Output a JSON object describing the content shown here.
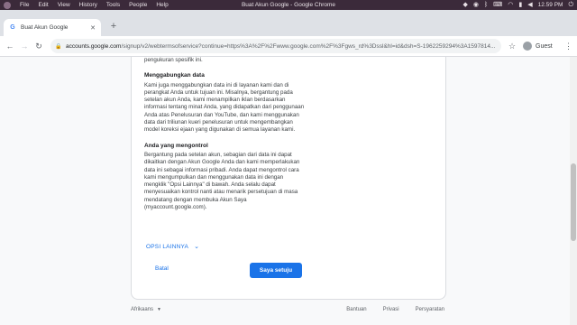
{
  "system_bar": {
    "menu": [
      "File",
      "Edit",
      "View",
      "History",
      "Tools",
      "People",
      "Help"
    ],
    "window_title": "Buat Akun Google - Google Chrome",
    "clock": "12.59 PM"
  },
  "browser": {
    "tab_title": "Buat Akun Google",
    "url_host": "accounts.google.com",
    "url_path": "/signup/v2/webtermsofservice?continue=https%3A%2F%2Fwww.google.com%2F%3Fgws_rd%3Dssl&hl=id&dsh=S-1962259294%3A1597814...",
    "profile_label": "Guest"
  },
  "page": {
    "cut_line": "pengukuran spesifik ini.",
    "sections": [
      {
        "heading": "Menggabungkan data",
        "body": "Kami juga menggabungkan data ini di layanan kami dan di perangkat Anda untuk tujuan ini. Misalnya, bergantung pada setelan akun Anda, kami menampilkan iklan berdasarkan informasi tentang minat Anda, yang didapatkan dari penggunaan Anda atas Penelusuran dan YouTube, dan kami menggunakan data dari triliunan kueri penelusuran untuk mengembangkan model koreksi ejaan yang digunakan di semua layanan kami."
      },
      {
        "heading": "Anda yang mengontrol",
        "body": "Bergantung pada setelan akun, sebagian dari data ini dapat dikaitkan dengan Akun Google Anda dan kami memperlakukan data ini sebagai informasi pribadi. Anda dapat mengontrol cara kami mengumpulkan dan menggunakan data ini dengan mengklik \"Opsi Lainnya\" di bawah. Anda selalu dapat menyesuaikan kontrol nanti atau menarik persetujuan di masa mendatang dengan membuka Akun Saya (myaccount.google.com)."
      }
    ],
    "more_options": "OPSI LAINNYA",
    "cancel": "Batal",
    "agree": "Saya setuju"
  },
  "footer": {
    "language": "Afrikaans",
    "links": [
      "Bantuan",
      "Privasi",
      "Persyaratan"
    ]
  }
}
